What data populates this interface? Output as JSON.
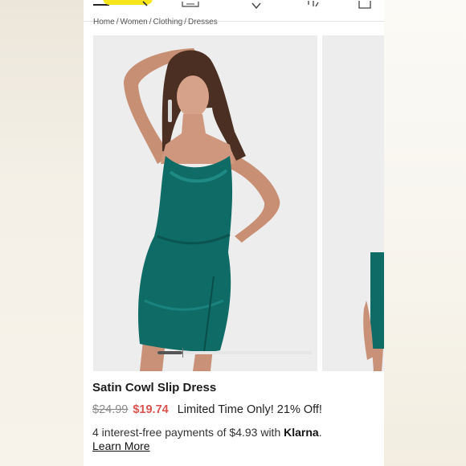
{
  "breadcrumb": [
    "Home",
    "Women",
    "Clothing",
    "Dresses"
  ],
  "breadcrumb_separator": "/",
  "gallery": {
    "main_image": "model-in-teal-satin-slip-dress",
    "next_image": "model-in-teal-satin-slip-dress-side",
    "progress": 0.16
  },
  "product": {
    "title": "Satin Cowl Slip Dress",
    "original_price": "$24.99",
    "sale_price": "$19.74",
    "promo": "Limited Time Only! 21% Off!"
  },
  "klarna": {
    "text": "4 interest-free payments of $4.93 with",
    "brand": "Klarna",
    "period": ".",
    "link": "Learn More"
  },
  "colors": {
    "sale_price": "#d9534f",
    "dress": "#0f6b66",
    "logo_pill": "#f7e61a"
  },
  "icons": [
    "menu-icon",
    "search-icon",
    "account-icon",
    "heart-icon",
    "user-icon",
    "bag-icon"
  ]
}
